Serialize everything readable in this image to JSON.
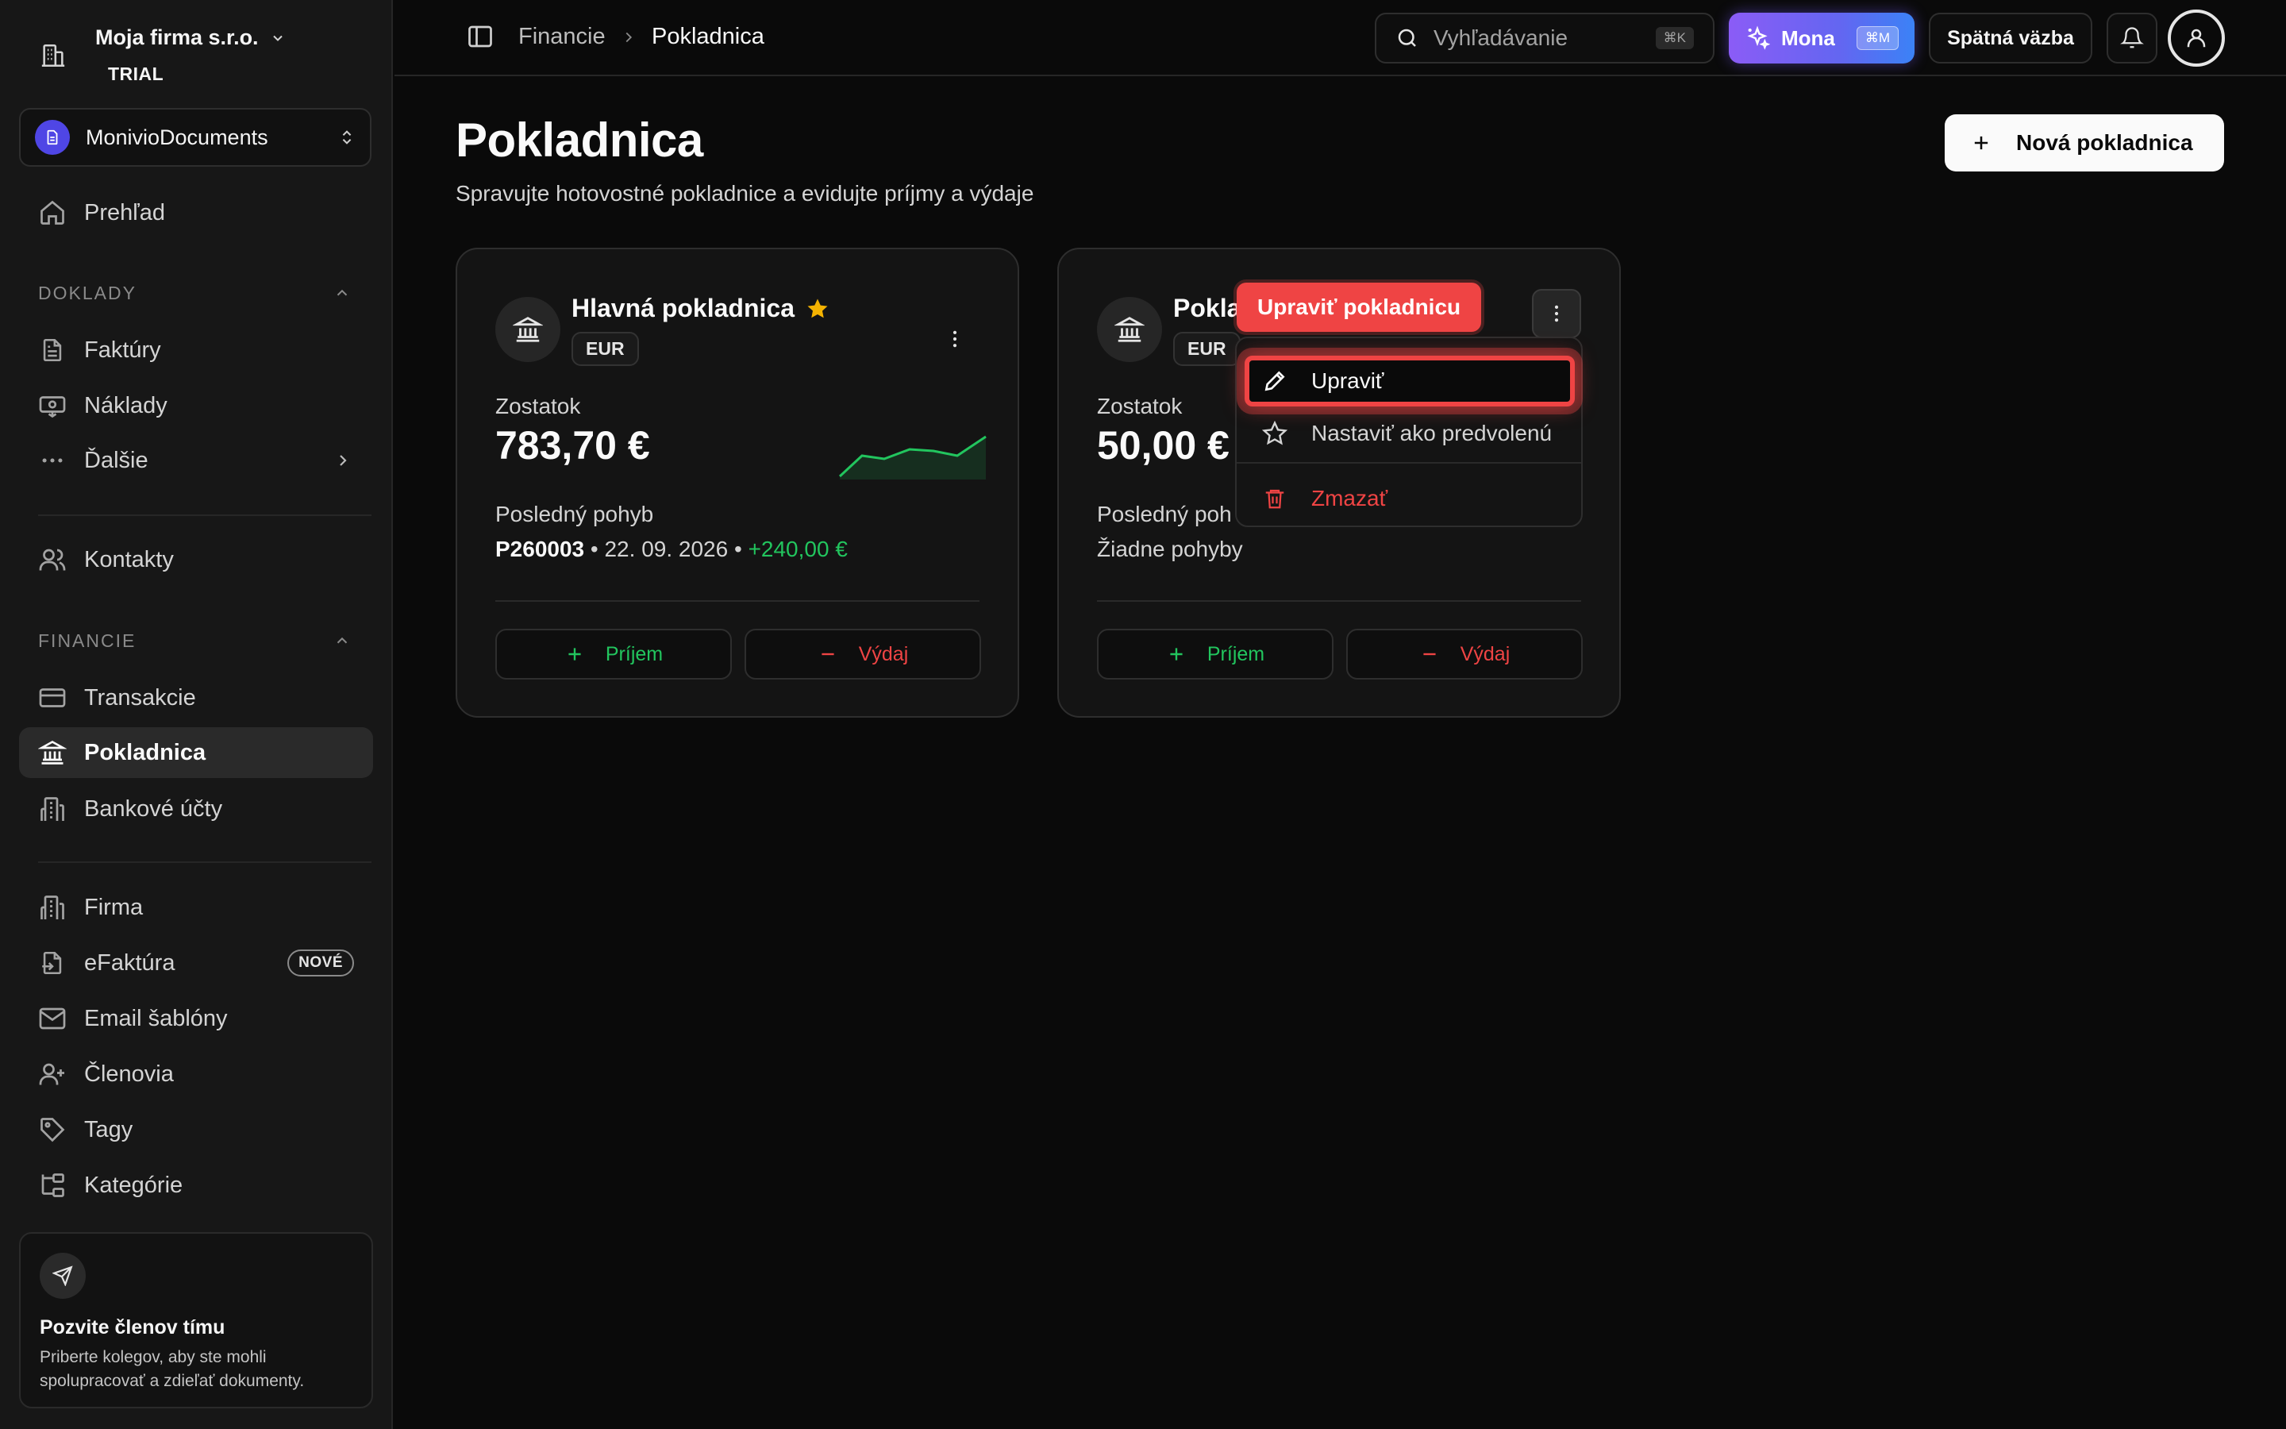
{
  "sidebar": {
    "org_name": "Moja firma s.r.o.",
    "org_plan": "TRIAL",
    "workspace": "MonivioDocuments",
    "overview": "Prehľad",
    "section_documents": "DOKLADY",
    "invoices": "Faktúry",
    "expenses": "Náklady",
    "more": "Ďalšie",
    "contacts": "Kontakty",
    "section_finance": "FINANCIE",
    "transactions": "Transakcie",
    "cashbox": "Pokladnica",
    "bank_accounts": "Bankové účty",
    "company": "Firma",
    "einvoice": "eFaktúra",
    "einvoice_badge": "NOVÉ",
    "email_templates": "Email šablóny",
    "members": "Členovia",
    "tags": "Tagy",
    "categories": "Kategórie",
    "invite_title": "Pozvite členov tímu",
    "invite_text": "Priberte kolegov, aby ste mohli spolupracovať a zdieľať dokumenty."
  },
  "topbar": {
    "crumb_parent": "Financie",
    "crumb_current": "Pokladnica",
    "search_placeholder": "Vyhľadávanie",
    "search_kbd": "⌘K",
    "mona_label": "Mona",
    "mona_kbd": "⌘M",
    "feedback": "Spätná väzba"
  },
  "main": {
    "title": "Pokladnica",
    "subtitle": "Spravujte hotovostné pokladnice a evidujte príjmy a výdaje",
    "new_button": "Nová pokladnica",
    "cards": [
      {
        "name": "Hlavná pokladnica",
        "currency": "EUR",
        "balance_label": "Zostatok",
        "balance": "783,70 €",
        "last_move_label": "Posledný pohyb",
        "last_move_doc": "P260003",
        "last_move_date": "22. 09. 2026",
        "last_move_amount": "+240,00 €",
        "income": "Príjem",
        "expense": "Výdaj"
      },
      {
        "name": "Pokla",
        "currency": "EUR",
        "balance_label": "Zostatok",
        "balance": "50,00 €",
        "last_move_label": "Posledný poh",
        "last_move_none": "Žiadne pohyby",
        "income": "Príjem",
        "expense": "Výdaj"
      }
    ]
  },
  "menu": {
    "tooltip": "Upraviť pokladnicu",
    "edit": "Upraviť",
    "set_default": "Nastaviť ako predvolenú",
    "delete": "Zmazať"
  },
  "colors": {
    "accent_green": "#22c55e",
    "accent_red": "#ef4444",
    "star": "#f5b301"
  }
}
